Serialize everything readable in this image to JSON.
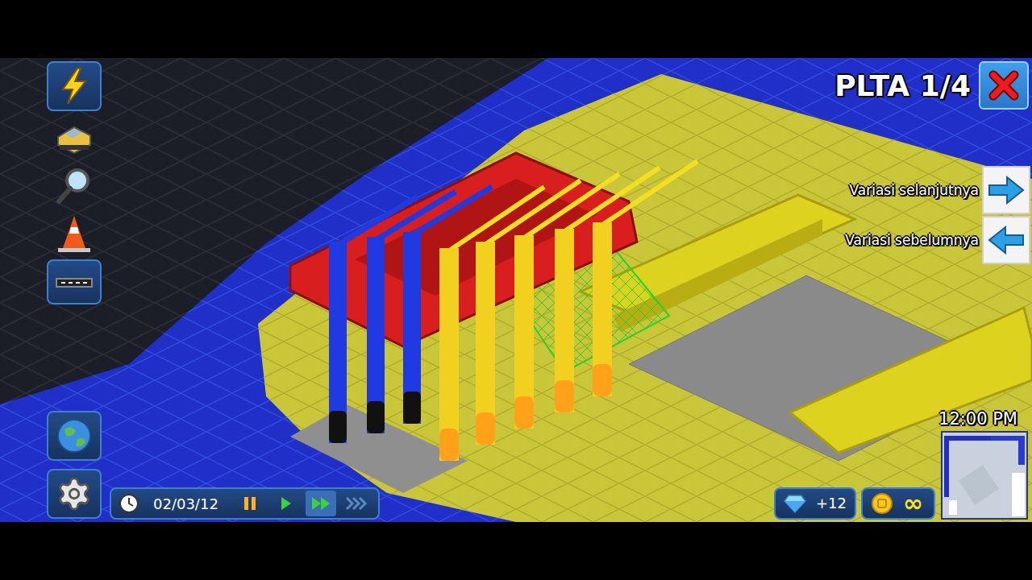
{
  "panel": {
    "title": "PLTA 1/4"
  },
  "variations": [
    {
      "label": "Variasi selanjutnya",
      "kind": "next"
    },
    {
      "label": "Variasi sebelumnya",
      "kind": "prev"
    }
  ],
  "toolbar": [
    {
      "kind": "power"
    },
    {
      "kind": "vehicle"
    },
    {
      "kind": "search"
    },
    {
      "kind": "cone"
    },
    {
      "kind": "road"
    }
  ],
  "bottom_tools": [
    {
      "kind": "globe"
    },
    {
      "kind": "settings"
    }
  ],
  "time_bar": {
    "date": "02/03/12",
    "speeds": [
      {
        "kind": "pause",
        "selected": false,
        "disabled": false
      },
      {
        "kind": "play",
        "selected": false,
        "disabled": false
      },
      {
        "kind": "fast",
        "selected": true,
        "disabled": false
      },
      {
        "kind": "fastest",
        "selected": false,
        "disabled": true
      }
    ]
  },
  "clock": "12:00 PM",
  "resources": [
    {
      "kind": "gems",
      "value": "+12"
    },
    {
      "kind": "coins",
      "value": "∞"
    }
  ]
}
